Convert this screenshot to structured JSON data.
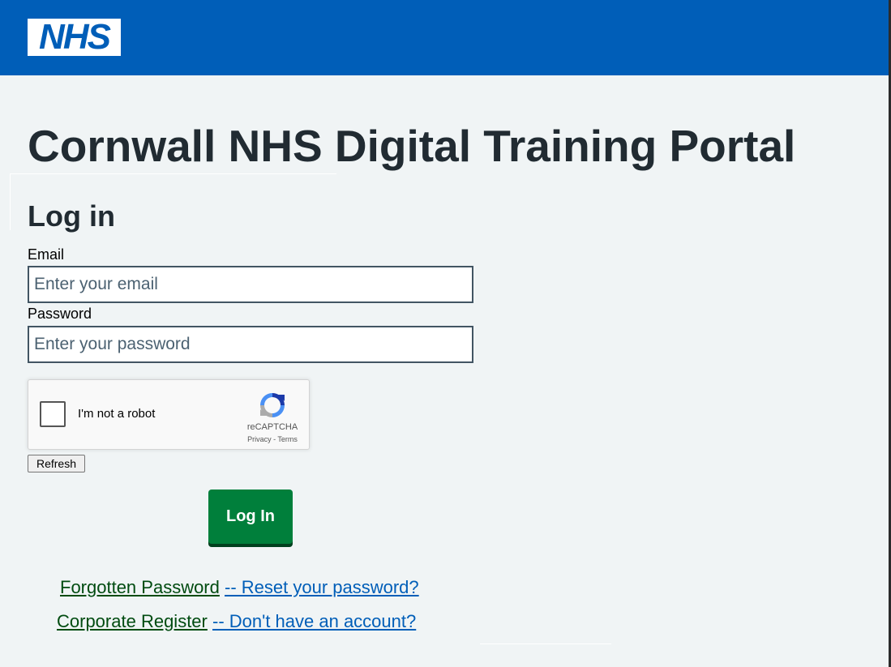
{
  "header": {
    "logo_text": "NHS",
    "brand_color": "#005eb8"
  },
  "page": {
    "title": "Cornwall NHS Digital Training Portal",
    "section_title": "Log in"
  },
  "form": {
    "email_label": "Email",
    "email_placeholder": "Enter your email",
    "email_value": "",
    "password_label": "Password",
    "password_placeholder": "Enter your password",
    "password_value": ""
  },
  "captcha": {
    "checkbox_label": "I'm not a robot",
    "brand": "reCAPTCHA",
    "links": "Privacy - Terms",
    "icon": "recaptcha-icon",
    "checked": false
  },
  "buttons": {
    "refresh_label": "Refresh",
    "login_label": "Log In",
    "login_color": "#007f3b"
  },
  "links": {
    "forgot_main": "Forgotten Password",
    "forgot_sub": "-- Reset your password?",
    "register_main": "Corporate Register",
    "register_sub": "-- Don't have an account?"
  }
}
